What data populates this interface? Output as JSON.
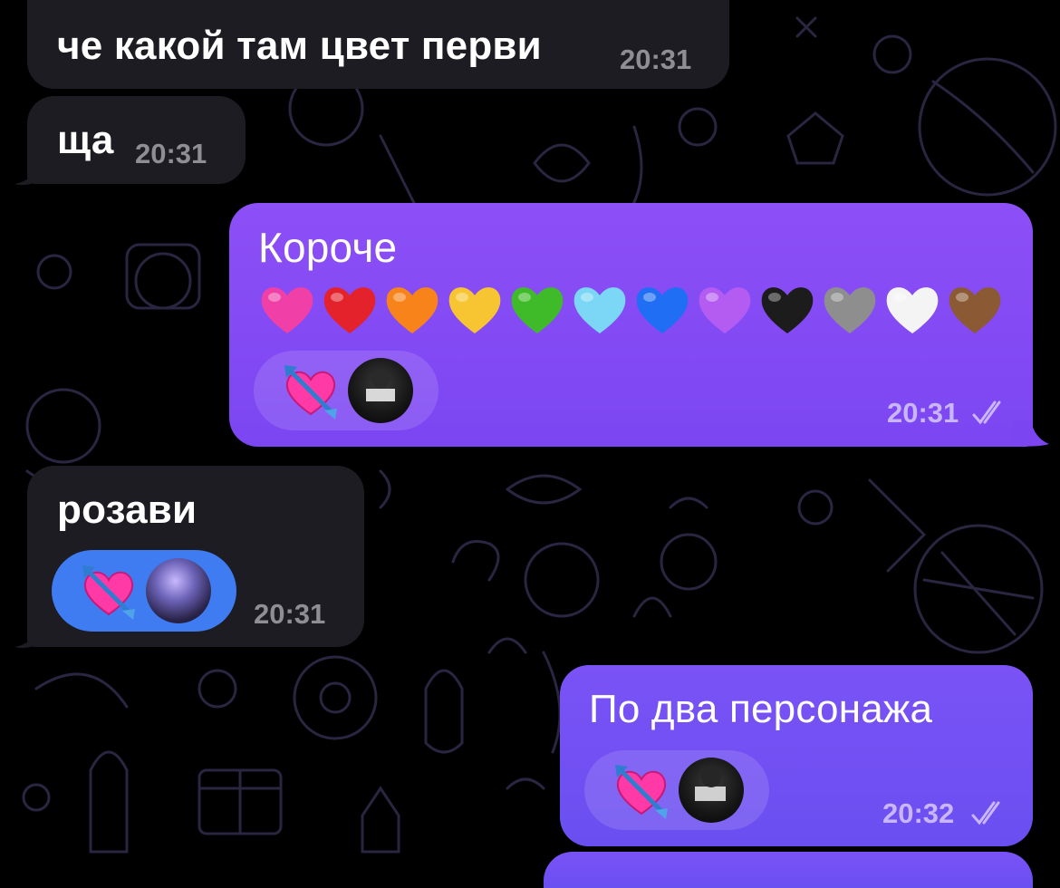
{
  "messages": [
    {
      "id": "m1",
      "direction": "incoming",
      "text": "че какой там цвет перви",
      "time": "20:31"
    },
    {
      "id": "m2",
      "direction": "incoming",
      "text": "ща",
      "time": "20:31"
    },
    {
      "id": "m3",
      "direction": "outgoing",
      "text": "Короче",
      "time": "20:31",
      "read": true,
      "emoji_hearts": [
        "#f03fa6",
        "#e3222b",
        "#f7831a",
        "#f6c531",
        "#3fbb2a",
        "#7bd7f5",
        "#1f6ef3",
        "#b45cf2",
        "#1c1c1c",
        "#8e8e8e",
        "#f4f4f4",
        "#8b5a34"
      ],
      "reaction": {
        "emoji": "heart-with-arrow",
        "avatar": "user-avatar"
      }
    },
    {
      "id": "m4",
      "direction": "incoming",
      "text": "розави",
      "time": "20:31",
      "reaction": {
        "emoji": "heart-with-arrow",
        "avatar": "contact-avatar"
      }
    },
    {
      "id": "m5",
      "direction": "outgoing",
      "text": "По два персонажа",
      "time": "20:32",
      "read": true,
      "reaction": {
        "emoji": "heart-with-arrow",
        "avatar": "user-avatar"
      }
    }
  ],
  "colors": {
    "background": "#000000",
    "incoming_bubble": "#1c1c22",
    "outgoing_bubble": "#8d4ff6",
    "incoming_reaction": "#3f7cf2"
  }
}
